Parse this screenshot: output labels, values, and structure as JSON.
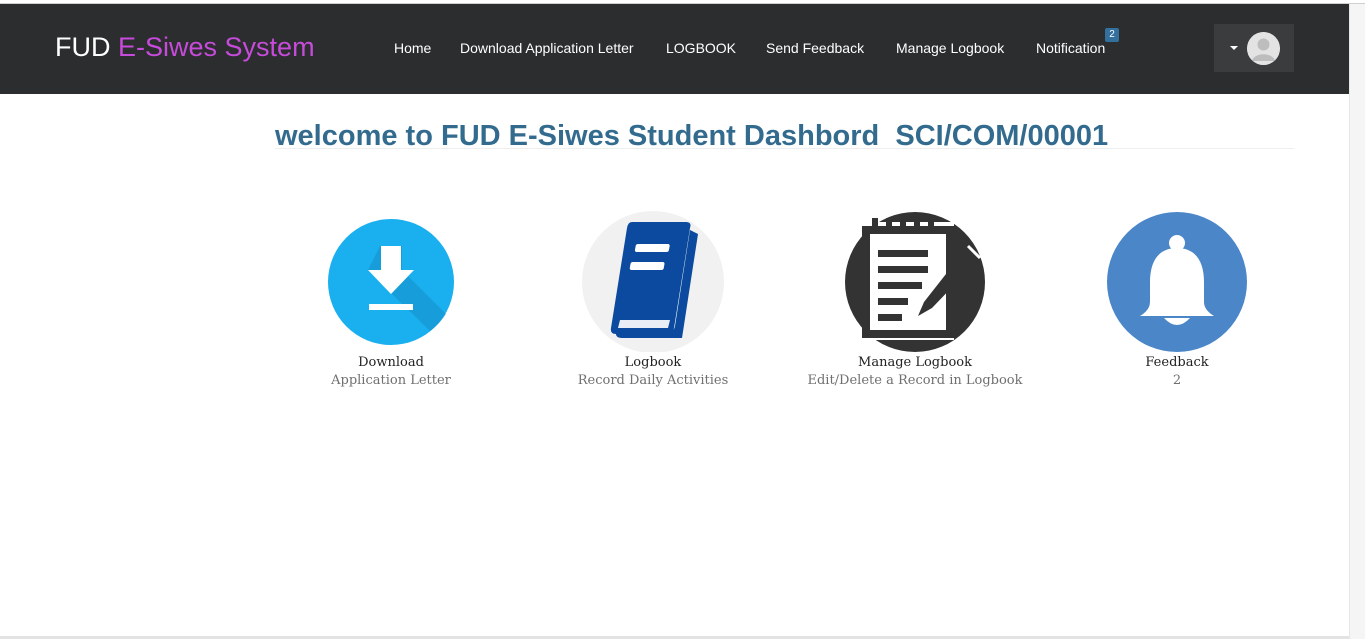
{
  "brand": {
    "prefix": "FUD",
    "accent": "E-Siwes System"
  },
  "nav": {
    "items": [
      {
        "label": "Home"
      },
      {
        "label": "Download Application Letter"
      },
      {
        "label": "LOGBOOK"
      },
      {
        "label": "Send Feedback"
      },
      {
        "label": "Manage Logbook"
      },
      {
        "label": "Notification"
      }
    ],
    "notification_count": "2"
  },
  "user_menu": {
    "icon": "user-avatar-icon"
  },
  "page": {
    "title": "welcome to FUD E-Siwes Student Dashbord  SCI/COM/00001"
  },
  "tiles": [
    {
      "title": "Download",
      "subtitle": "Application Letter",
      "icon": "download-icon"
    },
    {
      "title": "Logbook",
      "subtitle": "Record Daily Activities",
      "icon": "book-icon"
    },
    {
      "title": "Manage Logbook",
      "subtitle": "Edit/Delete a Record in Logbook",
      "icon": "notepad-pencil-icon"
    },
    {
      "title": "Feedback",
      "subtitle": "2",
      "icon": "bell-icon"
    }
  ],
  "colors": {
    "navbar": "#2b2d2f",
    "brand_accent": "#c74bdb",
    "title": "#336b8f",
    "badge": "#33709e",
    "download_circle": "#1ab0ef",
    "book": "#0b4a9e",
    "bell_circle": "#4a86c8"
  }
}
